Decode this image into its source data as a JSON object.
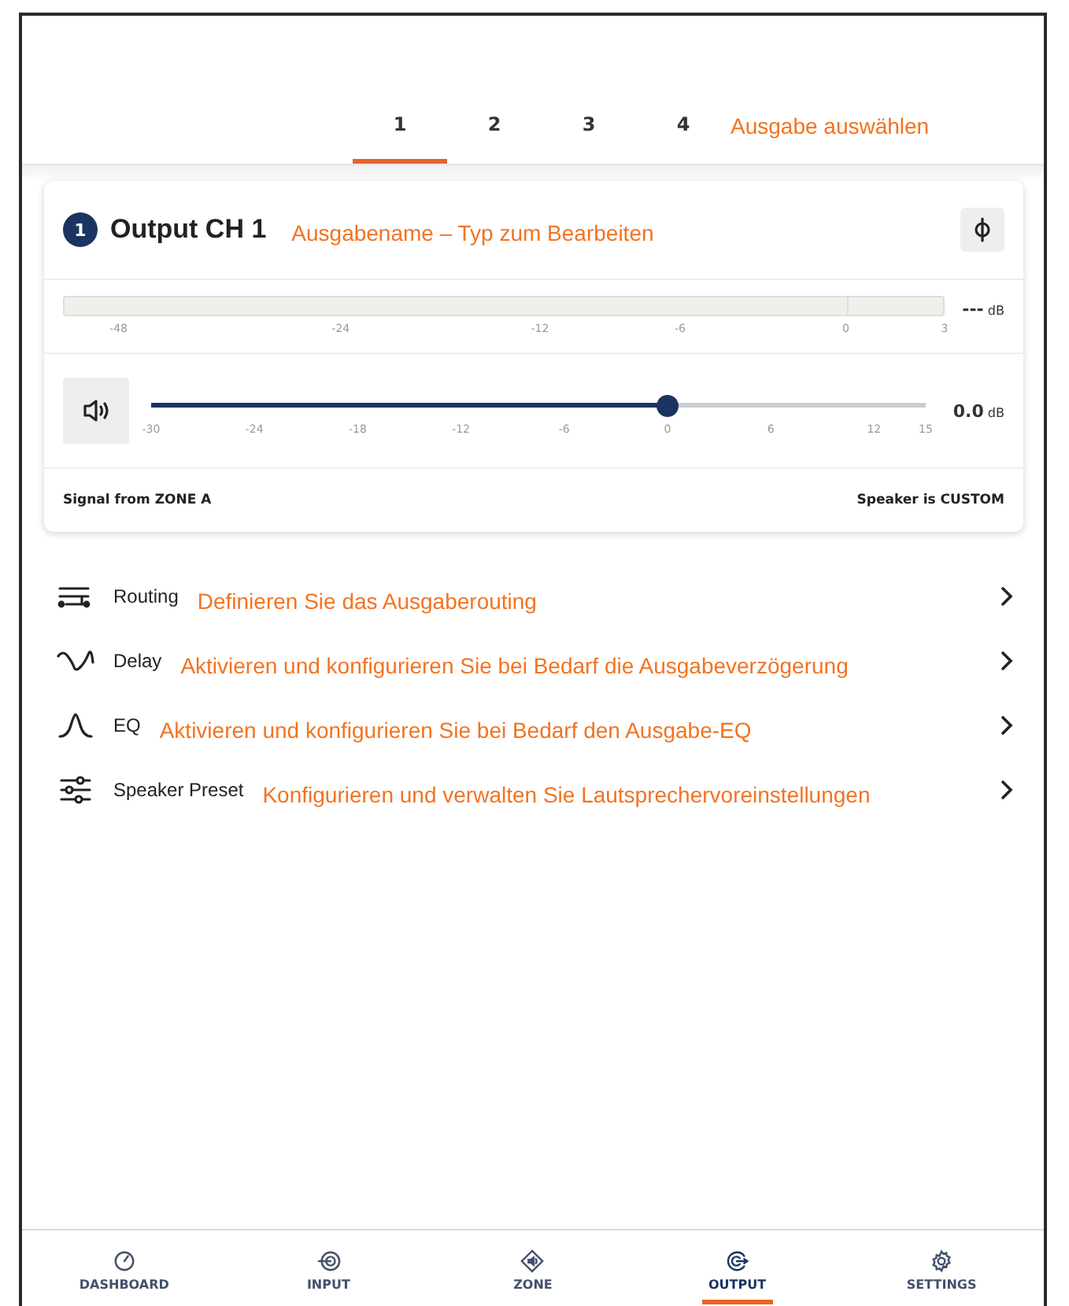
{
  "tabs": [
    {
      "label": "1",
      "selected": true
    },
    {
      "label": "2",
      "selected": false
    },
    {
      "label": "3",
      "selected": false
    },
    {
      "label": "4",
      "selected": false
    }
  ],
  "tabs_annotation": "Ausgabe auswählen",
  "output": {
    "number": "1",
    "name": "Output CH 1",
    "annotation": "Ausgabename – Typ zum Bearbeiten",
    "meter": {
      "reading": "---",
      "unit": "dB",
      "ticks": [
        "-48",
        "-24",
        "-12",
        "-6",
        "0",
        "3"
      ]
    },
    "volume": {
      "level": 0.667,
      "reading": "0.0",
      "unit": "dB",
      "ticks": [
        "-30",
        "-24",
        "-18",
        "-12",
        "-6",
        "0",
        "6",
        "12",
        "15"
      ]
    },
    "signal": "Signal from ZONE A",
    "speaker": "Speaker is CUSTOM"
  },
  "menu": [
    {
      "kind": "routing",
      "label": "Routing",
      "annotation": "Definieren Sie das Ausgaberouting"
    },
    {
      "kind": "delay",
      "label": "Delay",
      "annotation": "Aktivieren und konfigurieren Sie bei Bedarf die Ausgabeverzögerung"
    },
    {
      "kind": "eq",
      "label": "EQ",
      "annotation": "Aktivieren und konfigurieren Sie bei Bedarf den Ausgabe-EQ"
    },
    {
      "kind": "preset",
      "label": "Speaker Preset",
      "annotation": "Konfigurieren und verwalten Sie Lautsprechervoreinstellungen"
    }
  ],
  "nav": [
    {
      "kind": "dashboard",
      "label": "DASHBOARD",
      "selected": false
    },
    {
      "kind": "input",
      "label": "INPUT",
      "selected": false
    },
    {
      "kind": "zone",
      "label": "ZONE",
      "selected": false
    },
    {
      "kind": "output",
      "label": "OUTPUT",
      "selected": true
    },
    {
      "kind": "settings",
      "label": "SETTINGS",
      "selected": false
    }
  ]
}
